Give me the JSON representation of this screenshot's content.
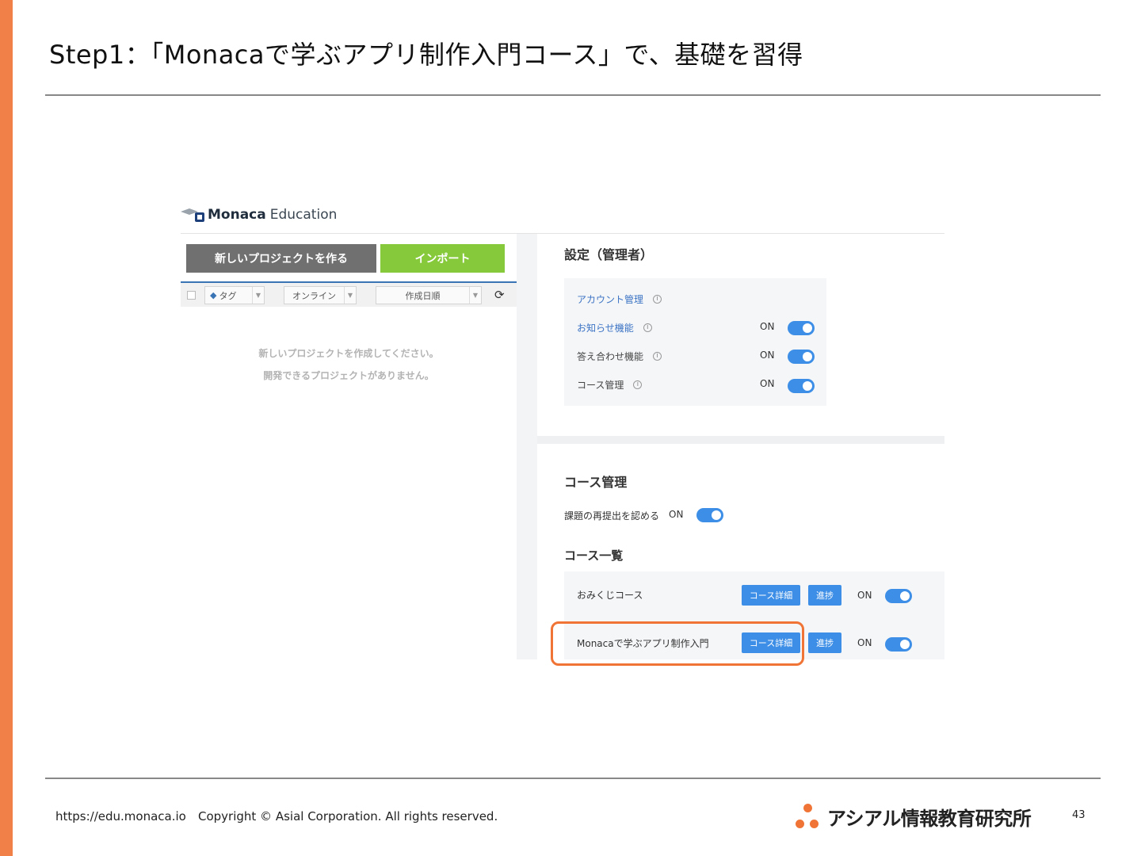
{
  "slide": {
    "title": "Step1：「Monacaで学ぶアプリ制作入門コース」で、基礎を習得",
    "page_number": "43"
  },
  "app": {
    "logo_brand": "Monaca",
    "logo_product": "Education"
  },
  "left_panel": {
    "new_project_button": "新しいプロジェクトを作る",
    "import_button": "インポート",
    "filter_tag": "タグ",
    "filter_online": "オンライン",
    "filter_sort": "作成日順",
    "empty_line1": "新しいプロジェクトを作成してください。",
    "empty_line2": "開発できるプロジェクトがありません。"
  },
  "settings": {
    "title": "設定（管理者）",
    "rows": [
      {
        "label": "アカウント管理",
        "status": ""
      },
      {
        "label": "お知らせ機能",
        "status": "ON"
      },
      {
        "label": "答え合わせ機能",
        "status": "ON"
      },
      {
        "label": "コース管理",
        "status": "ON"
      }
    ]
  },
  "course_management": {
    "title": "コース管理",
    "resubmit_label": "課題の再提出を認める",
    "resubmit_status": "ON",
    "list_title": "コース一覧",
    "detail_button": "コース詳細",
    "progress_button": "進捗",
    "courses": [
      {
        "name": "おみくじコース",
        "status": "ON"
      },
      {
        "name": "Monacaで学ぶアプリ制作入門",
        "status": "ON"
      }
    ]
  },
  "footer": {
    "url": "https://edu.monaca.io",
    "copyright": "Copyright © Asial Corporation. All rights reserved.",
    "org_name": "アシアル情報教育研究所"
  },
  "colors": {
    "accent_orange": "#f08048",
    "toggle_blue": "#3d8ee6",
    "import_green": "#86c93a",
    "link_blue": "#3b73c4"
  }
}
